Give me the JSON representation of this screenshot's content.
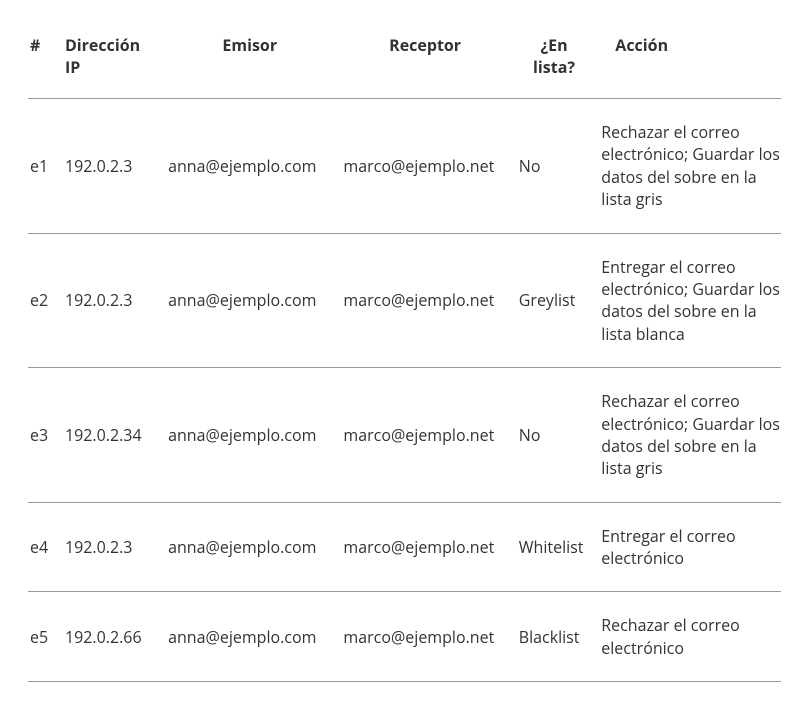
{
  "table": {
    "headers": {
      "num": "#",
      "ip": "Dirección IP",
      "sender": "Emisor",
      "receiver": "Receptor",
      "listed": "¿En lista?",
      "action": "Acción"
    },
    "rows": [
      {
        "num": "e1",
        "ip": "192.0.2.3",
        "sender": "anna@ejemplo.com",
        "receiver": "marco@ejemplo.net",
        "listed": "No",
        "action": "Rechazar el correo electrónico;\nGuardar los datos del sobre en la lista gris"
      },
      {
        "num": "e2",
        "ip": "192.0.2.3",
        "sender": "anna@ejemplo.com",
        "receiver": "marco@ejemplo.net",
        "listed": "Greylist",
        "action": "Entregar el correo electrónico;\nGuardar los datos del sobre en la lista blanca"
      },
      {
        "num": "e3",
        "ip": "192.0.2.34",
        "sender": "anna@ejemplo.com",
        "receiver": "marco@ejemplo.net",
        "listed": "No",
        "action": "Rechazar el correo electrónico;\nGuardar los datos del sobre en la lista gris"
      },
      {
        "num": "e4",
        "ip": "192.0.2.3",
        "sender": "anna@ejemplo.com",
        "receiver": "marco@ejemplo.net",
        "listed": "Whitelist",
        "action": "Entregar el correo electrónico"
      },
      {
        "num": "e5",
        "ip": "192.0.2.66",
        "sender": "anna@ejemplo.com",
        "receiver": "marco@ejemplo.net",
        "listed": "Blacklist",
        "action": "Rechazar el correo electrónico"
      }
    ]
  }
}
